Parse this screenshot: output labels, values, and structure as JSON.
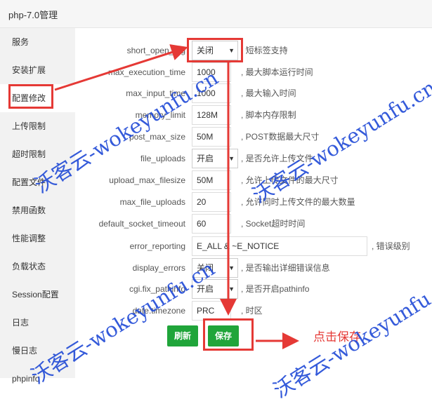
{
  "window": {
    "title": "php-7.0管理"
  },
  "sidebar": {
    "items": [
      {
        "label": "服务"
      },
      {
        "label": "安装扩展"
      },
      {
        "label": "配置修改",
        "active": true
      },
      {
        "label": "上传限制"
      },
      {
        "label": "超时限制"
      },
      {
        "label": "配置文件"
      },
      {
        "label": "禁用函数"
      },
      {
        "label": "性能调整"
      },
      {
        "label": "负载状态"
      },
      {
        "label": "Session配置"
      },
      {
        "label": "日志"
      },
      {
        "label": "慢日志"
      },
      {
        "label": "phpinfo"
      }
    ]
  },
  "settings": [
    {
      "key": "short_open_tag",
      "type": "select",
      "value": "关闭",
      "desc": ", 短标签支持"
    },
    {
      "key": "max_execution_time",
      "type": "input",
      "value": "1000",
      "desc": ", 最大脚本运行时间"
    },
    {
      "key": "max_input_time",
      "type": "input",
      "value": "1000",
      "desc": ", 最大输入时间"
    },
    {
      "key": "memory_limit",
      "type": "input",
      "value": "128M",
      "desc": ", 脚本内存限制"
    },
    {
      "key": "post_max_size",
      "type": "input",
      "value": "50M",
      "desc": ", POST数据最大尺寸"
    },
    {
      "key": "file_uploads",
      "type": "select",
      "value": "开启",
      "desc": ", 是否允许上传文件"
    },
    {
      "key": "upload_max_filesize",
      "type": "input",
      "value": "50M",
      "desc": ", 允许上传文件的最大尺寸"
    },
    {
      "key": "max_file_uploads",
      "type": "input",
      "value": "20",
      "desc": ", 允许同时上传文件的最大数量"
    },
    {
      "key": "default_socket_timeout",
      "type": "input",
      "value": "60",
      "desc": ", Socket超时时间"
    },
    {
      "key": "error_reporting",
      "type": "input-wide",
      "value": "E_ALL & ~E_NOTICE",
      "desc": ", 错误级别"
    },
    {
      "key": "display_errors",
      "type": "select",
      "value": "关闭",
      "desc": ", 是否输出详细错误信息"
    },
    {
      "key": "cgi.fix_pathinfo",
      "type": "select",
      "value": "开启",
      "desc": ", 是否开启pathinfo"
    },
    {
      "key": "date.timezone",
      "type": "input",
      "value": "PRC",
      "desc": ", 时区"
    }
  ],
  "actions": {
    "refresh_label": "刷新",
    "save_label": "保存"
  },
  "annotation": {
    "text": "点击保存"
  },
  "watermark": {
    "text": "沃客云-wokeyunfu.cn"
  },
  "colors": {
    "accent": "#20a53a",
    "annotation": "#e53935",
    "watermark": "#1f49d6"
  }
}
